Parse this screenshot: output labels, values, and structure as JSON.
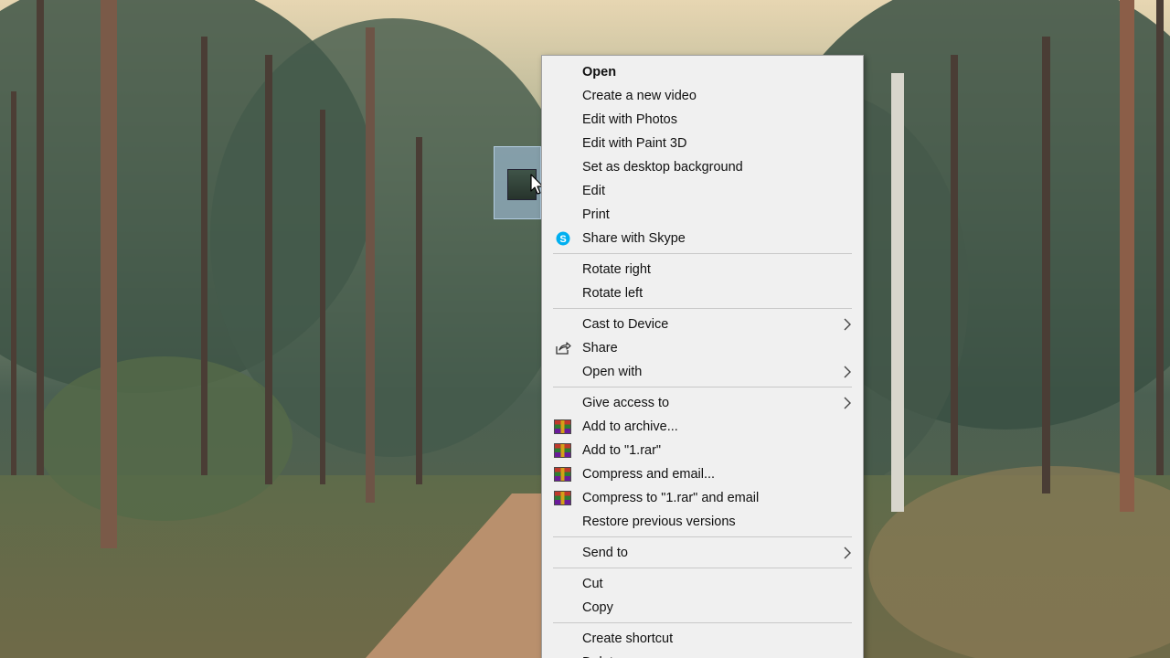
{
  "menu": {
    "groups": [
      [
        {
          "label": "Open",
          "bold": true
        },
        {
          "label": "Create a new video"
        },
        {
          "label": "Edit with Photos"
        },
        {
          "label": "Edit with Paint 3D"
        },
        {
          "label": "Set as desktop background"
        },
        {
          "label": "Edit"
        },
        {
          "label": "Print"
        },
        {
          "label": "Share with Skype",
          "icon": "skype-icon"
        }
      ],
      [
        {
          "label": "Rotate right"
        },
        {
          "label": "Rotate left"
        }
      ],
      [
        {
          "label": "Cast to Device",
          "submenu": true
        },
        {
          "label": "Share",
          "icon": "share-icon"
        },
        {
          "label": "Open with",
          "submenu": true
        }
      ],
      [
        {
          "label": "Give access to",
          "submenu": true
        },
        {
          "label": "Add to archive...",
          "icon": "winrar-icon"
        },
        {
          "label": "Add to \"1.rar\"",
          "icon": "winrar-icon"
        },
        {
          "label": "Compress and email...",
          "icon": "winrar-icon"
        },
        {
          "label": "Compress to \"1.rar\" and email",
          "icon": "winrar-icon"
        },
        {
          "label": "Restore previous versions"
        }
      ],
      [
        {
          "label": "Send to",
          "submenu": true
        }
      ],
      [
        {
          "label": "Cut"
        },
        {
          "label": "Copy"
        }
      ],
      [
        {
          "label": "Create shortcut"
        },
        {
          "label": "Delete"
        }
      ]
    ]
  },
  "colors": {
    "menu_background": "#f0f0f0",
    "skype_blue": "#00aff0"
  }
}
